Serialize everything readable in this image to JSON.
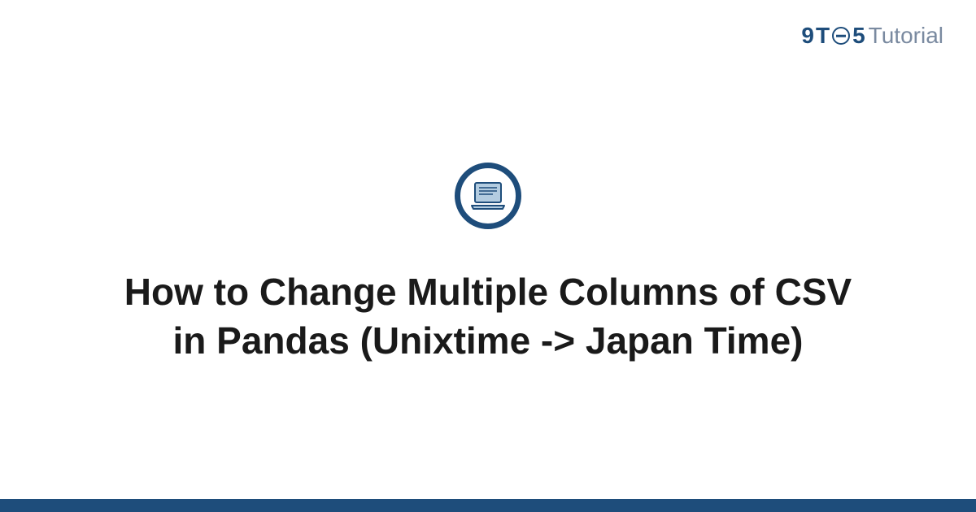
{
  "brand": {
    "nine": "9",
    "t": "T",
    "five": "5",
    "tutorial": "Tutorial"
  },
  "title": "How to Change Multiple Columns of CSV in Pandas (Unixtime -> Japan Time)",
  "colors": {
    "primary": "#1e4d7b",
    "muted": "#7a8aa0",
    "iconFill": "#b3cce0"
  }
}
